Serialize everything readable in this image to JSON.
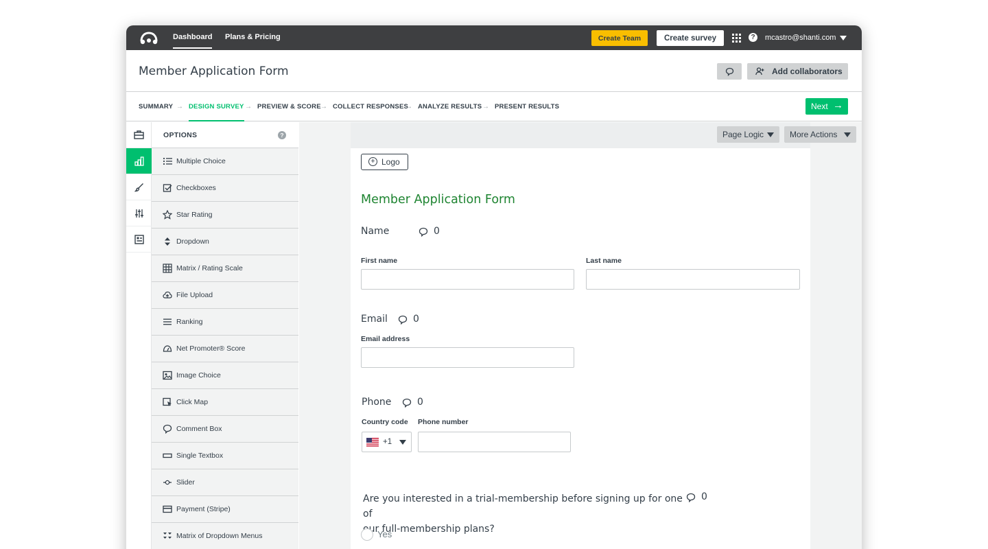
{
  "colors": {
    "topbar": "#3e3f41",
    "accent": "#00bf6f",
    "title_green": "#1e8431",
    "create_team": "#f9be00"
  },
  "topbar": {
    "logo_icon": "surveymonkey-logo-icon",
    "nav": [
      {
        "label": "Dashboard"
      },
      {
        "label": "Plans & Pricing"
      }
    ],
    "create_team_label": "Create Team",
    "create_survey_label": "Create survey",
    "apps_icon": "apps-grid-icon",
    "help_icon": "help-icon",
    "help_glyph": "?",
    "user_email": "mcastro@shanti.com"
  },
  "titlebar": {
    "title": "Member Application Form",
    "comment_icon": "comment-icon",
    "add_collaborators_label": "Add collaborators"
  },
  "steps": [
    {
      "label": "SUMMARY"
    },
    {
      "label": "DESIGN SURVEY"
    },
    {
      "label": "PREVIEW & SCORE"
    },
    {
      "label": "COLLECT RESPONSES"
    },
    {
      "label": "ANALYZE RESULTS"
    },
    {
      "label": "PRESENT RESULTS"
    }
  ],
  "step_arrow": "→",
  "active_step": "DESIGN SURVEY",
  "next_label": "Next",
  "next_arrow": "→",
  "rail": [
    {
      "icon": "briefcase-icon"
    },
    {
      "icon": "builder-icon"
    },
    {
      "icon": "paintbrush-icon"
    },
    {
      "icon": "sliders-icon"
    },
    {
      "icon": "form-icon"
    }
  ],
  "options": {
    "title": "OPTIONS",
    "help_glyph": "?",
    "items": [
      {
        "label": "Multiple Choice",
        "icon": "list-icon"
      },
      {
        "label": "Checkboxes",
        "icon": "checkbox-icon"
      },
      {
        "label": "Star Rating",
        "icon": "star-icon"
      },
      {
        "label": "Dropdown",
        "icon": "dropdown-icon"
      },
      {
        "label": "Matrix / Rating Scale",
        "icon": "grid-icon"
      },
      {
        "label": "File Upload",
        "icon": "cloud-upload-icon"
      },
      {
        "label": "Ranking",
        "icon": "ranking-icon"
      },
      {
        "label": "Net Promoter® Score",
        "icon": "gauge-icon"
      },
      {
        "label": "Image Choice",
        "icon": "image-icon"
      },
      {
        "label": "Click Map",
        "icon": "click-map-icon"
      },
      {
        "label": "Comment Box",
        "icon": "comment-icon"
      },
      {
        "label": "Single Textbox",
        "icon": "textbox-icon"
      },
      {
        "label": "Slider",
        "icon": "slider-icon"
      },
      {
        "label": "Payment (Stripe)",
        "icon": "credit-card-icon"
      },
      {
        "label": "Matrix of Dropdown Menus",
        "icon": "matrix-dropdown-icon"
      }
    ]
  },
  "canvas": {
    "page_logic_label": "Page Logic",
    "more_actions_label": "More Actions",
    "logo_button_label": "Logo",
    "logo_plus": "+",
    "survey_title": "Member Application Form",
    "questions": {
      "name": {
        "label": "Name",
        "comments": "0",
        "first_label": "First name",
        "last_label": "Last name"
      },
      "email": {
        "label": "Email",
        "comments": "0",
        "field_label": "Email address"
      },
      "phone": {
        "label": "Phone",
        "comments": "0",
        "country_label": "Country code",
        "number_label": "Phone number",
        "country_code": "+1",
        "flag_icon": "us-flag-icon"
      },
      "trial": {
        "line1": "Are you interested in a trial-membership before signing up for one of",
        "line2": "our full-membership plans?",
        "comments": "0",
        "options": [
          {
            "label": "Yes"
          }
        ]
      }
    }
  }
}
